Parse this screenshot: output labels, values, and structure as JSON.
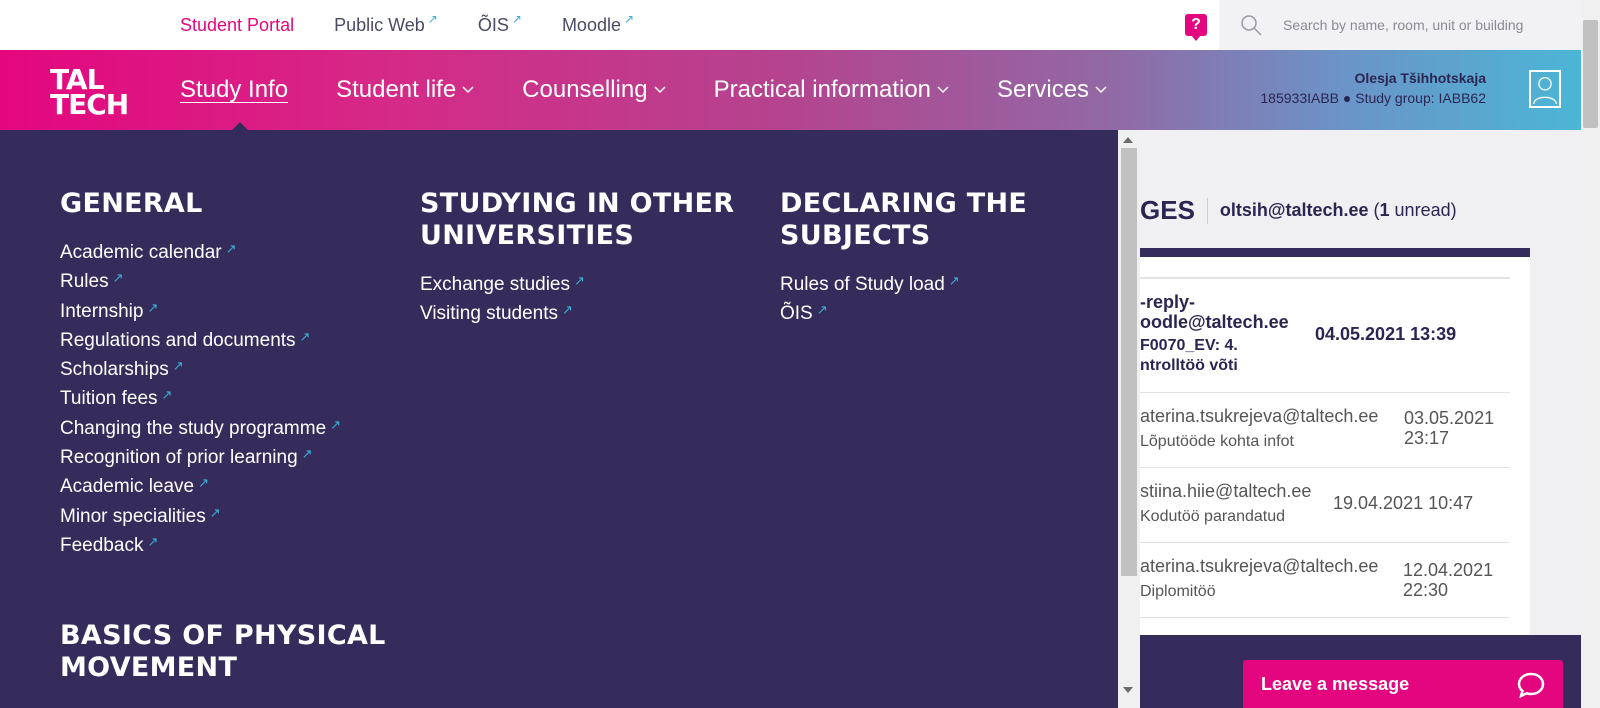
{
  "top_links": [
    {
      "label": "Student Portal",
      "external": false,
      "active": true
    },
    {
      "label": "Public Web",
      "external": true
    },
    {
      "label": "ÕIS",
      "external": true
    },
    {
      "label": "Moodle",
      "external": true
    }
  ],
  "help": {
    "label": "?"
  },
  "search": {
    "placeholder": "Search by name, room, unit or building"
  },
  "logo": {
    "line1": "TAL",
    "line2": "TECH"
  },
  "nav": [
    {
      "label": "Study Info",
      "active": true,
      "has_dropdown": false
    },
    {
      "label": "Student life",
      "has_dropdown": true
    },
    {
      "label": "Counselling",
      "has_dropdown": true
    },
    {
      "label": "Practical information",
      "has_dropdown": true
    },
    {
      "label": "Services",
      "has_dropdown": true
    }
  ],
  "user": {
    "name": "Olesja Tšihhotskaja",
    "details": "185933IABB ● Study group: IABB62"
  },
  "menu": {
    "columns": [
      {
        "title": "GENERAL",
        "links": [
          "Academic calendar",
          "Rules",
          "Internship",
          "Regulations and documents",
          "Scholarships",
          "Tuition fees",
          "Changing the study programme",
          "Recognition of prior learning",
          "Academic leave",
          "Minor specialities",
          "Feedback"
        ]
      },
      {
        "title": "STUDYING IN OTHER UNIVERSITIES",
        "links": [
          "Exchange studies",
          "Visiting students"
        ]
      },
      {
        "title": "DECLARING THE SUBJECTS",
        "links": [
          "Rules of Study load",
          "ÕIS"
        ]
      }
    ],
    "second_section_title": "BASICS OF PHYSICAL MOVEMENT"
  },
  "messages": {
    "title_fragment": "GES",
    "account": "oltsih@taltech.ee",
    "unread_count": "1",
    "unread_label": "unread",
    "rows": [
      {
        "from": "-reply-\noodle@taltech.ee",
        "subject": "F0070_EV: 4.\nntrolltöö võti",
        "date": "04.05.2021 13:39",
        "unread": true
      },
      {
        "from": "aterina.tsukrejeva@taltech.ee",
        "subject": "Lõputööde kohta infot",
        "date": "03.05.2021\n23:17",
        "unread": false
      },
      {
        "from": "stiina.hiie@taltech.ee",
        "subject": "Kodutöö parandatud",
        "date": "19.04.2021 10:47",
        "unread": false
      },
      {
        "from": "aterina.tsukrejeva@taltech.ee",
        "subject": "Diplomitöö",
        "date": "12.04.2021\n22:30",
        "unread": false
      }
    ]
  },
  "chat": {
    "label": "Leave a message"
  },
  "colors": {
    "brand_pink": "#e4067e",
    "menu_bg": "#352c5c",
    "link_arrow": "#3bb0d8"
  }
}
